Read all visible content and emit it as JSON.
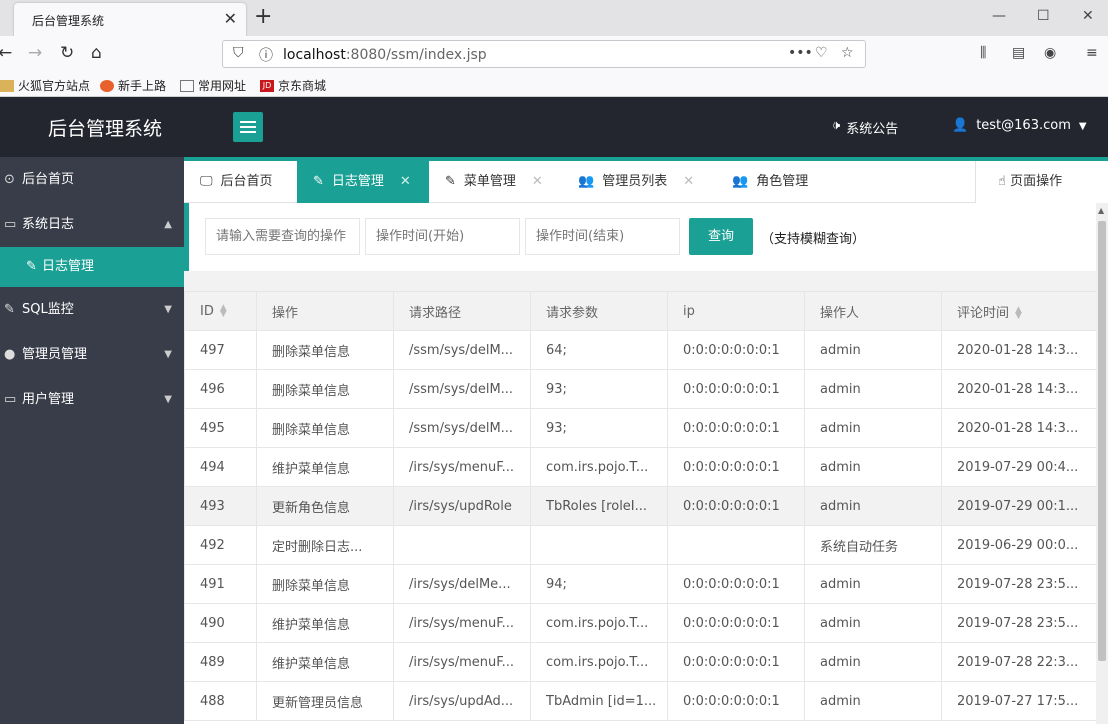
{
  "browser": {
    "tab_title": "后台管理系统",
    "url_host": "localhost",
    "url_rest": ":8080/ssm/index.jsp",
    "bookmarks": [
      "火狐官方站点",
      "新手上路",
      "常用网址",
      "京东商城"
    ]
  },
  "header": {
    "logo": "后台管理系统",
    "notice": "系统公告",
    "user_email": "test@163.com"
  },
  "sidebar": {
    "items": [
      {
        "label": "后台首页"
      },
      {
        "label": "系统日志"
      },
      {
        "label": "日志管理"
      },
      {
        "label": "SQL监控"
      },
      {
        "label": "管理员管理"
      },
      {
        "label": "用户管理"
      }
    ]
  },
  "tabs": {
    "items": [
      {
        "label": "后台首页"
      },
      {
        "label": "日志管理"
      },
      {
        "label": "菜单管理"
      },
      {
        "label": "管理员列表"
      },
      {
        "label": "角色管理"
      }
    ],
    "page_ops": "页面操作"
  },
  "search": {
    "op_placeholder": "请输入需要查询的操作",
    "start_placeholder": "操作时间(开始)",
    "end_placeholder": "操作时间(结束)",
    "button": "查询",
    "hint": "（支持模糊查询）"
  },
  "table": {
    "columns": [
      "ID",
      "操作",
      "请求路径",
      "请求参数",
      "ip",
      "操作人",
      "评论时间"
    ],
    "rows": [
      [
        "497",
        "删除菜单信息",
        "/ssm/sys/delM...",
        "64;",
        "0:0:0:0:0:0:0:1",
        "admin",
        "2020-01-28 14:3..."
      ],
      [
        "496",
        "删除菜单信息",
        "/ssm/sys/delM...",
        "93;",
        "0:0:0:0:0:0:0:1",
        "admin",
        "2020-01-28 14:3..."
      ],
      [
        "495",
        "删除菜单信息",
        "/ssm/sys/delM...",
        "93;",
        "0:0:0:0:0:0:0:1",
        "admin",
        "2020-01-28 14:3..."
      ],
      [
        "494",
        "维护菜单信息",
        "/irs/sys/menuF...",
        "com.irs.pojo.T...",
        "0:0:0:0:0:0:0:1",
        "admin",
        "2019-07-29 00:4..."
      ],
      [
        "493",
        "更新角色信息",
        "/irs/sys/updRole",
        "TbRoles [roleI...",
        "0:0:0:0:0:0:0:1",
        "admin",
        "2019-07-29 00:1..."
      ],
      [
        "492",
        "定时删除日志...",
        "",
        "",
        "",
        "系统自动任务",
        "2019-06-29 00:0..."
      ],
      [
        "491",
        "删除菜单信息",
        "/irs/sys/delMe...",
        "94;",
        "0:0:0:0:0:0:0:1",
        "admin",
        "2019-07-28 23:5..."
      ],
      [
        "490",
        "维护菜单信息",
        "/irs/sys/menuF...",
        "com.irs.pojo.T...",
        "0:0:0:0:0:0:0:1",
        "admin",
        "2019-07-28 23:5..."
      ],
      [
        "489",
        "维护菜单信息",
        "/irs/sys/menuF...",
        "com.irs.pojo.T...",
        "0:0:0:0:0:0:0:1",
        "admin",
        "2019-07-28 22:3..."
      ],
      [
        "488",
        "更新管理员信息",
        "/irs/sys/updAd...",
        "TbAdmin [id=1...",
        "0:0:0:0:0:0:0:1",
        "admin",
        "2019-07-27 17:5..."
      ]
    ]
  },
  "colors": {
    "accent": "#1aa094",
    "header": "#23262e",
    "sidebar": "#393d49"
  }
}
